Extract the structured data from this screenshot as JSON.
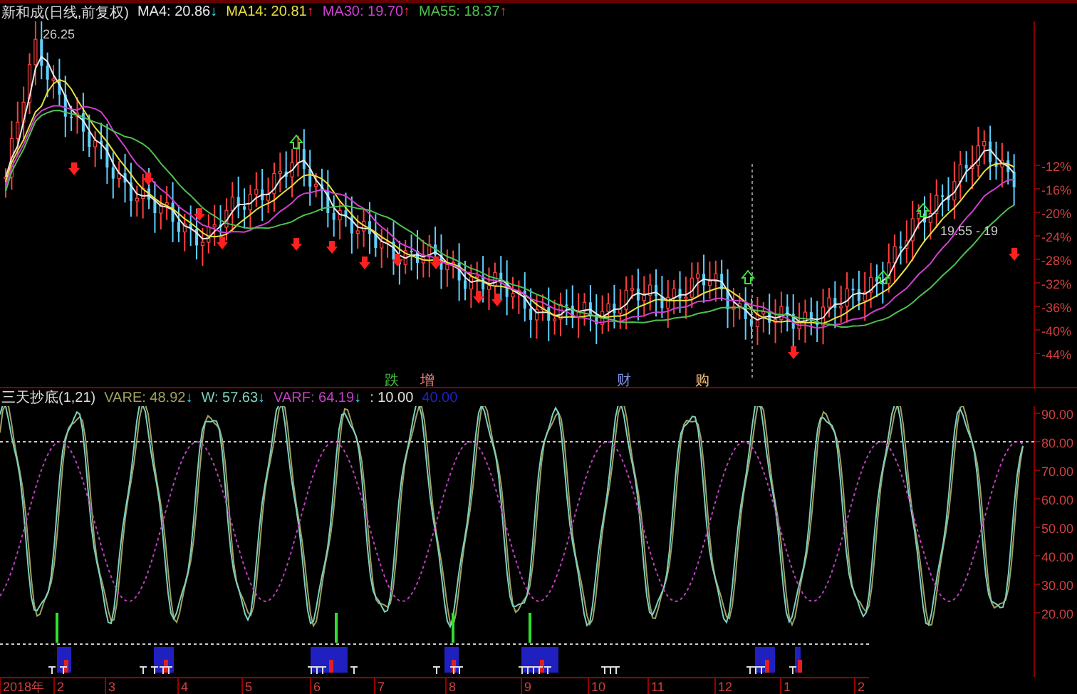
{
  "main_panel": {
    "title": "新和成(日线,前复权)",
    "indicators": [
      {
        "label": "MA4: 20.86",
        "arrow": "↓",
        "rising": false,
        "color": "#e8e8e8"
      },
      {
        "label": "MA14: 20.81",
        "arrow": "↑",
        "rising": true,
        "color": "#e8e040"
      },
      {
        "label": "MA30: 19.70",
        "arrow": "↑",
        "rising": true,
        "color": "#d040d0"
      },
      {
        "label": "MA55: 18.37",
        "arrow": "↑",
        "rising": true,
        "color": "#50c050"
      }
    ],
    "peak_label": "26.25",
    "price_label": "19.55 - 19",
    "axis_labels": [
      "-12%",
      "-16%",
      "-20%",
      "-24%",
      "-28%",
      "-32%",
      "-36%",
      "-40%",
      "-44%"
    ],
    "event_tags": [
      {
        "text": "跌",
        "color": "#40c040"
      },
      {
        "text": "增",
        "color": "#f08080"
      },
      {
        "text": "财",
        "color": "#8090e0"
      },
      {
        "text": "购",
        "color": "#f0c080"
      }
    ]
  },
  "indicator_panel": {
    "title": "三天抄底(1,21)",
    "values": [
      {
        "label": "VARE: 48.92",
        "arrow": "↓",
        "rising": false,
        "color": "#a0a060"
      },
      {
        "label": "W: 57.63",
        "arrow": "↓",
        "rising": false,
        "color": "#80d0c0"
      },
      {
        "label": "VARF: 64.19",
        "arrow": "↓",
        "rising": false,
        "color": "#c040c0"
      },
      {
        "label": ": 10.00",
        "color": "#e0e0e0"
      },
      {
        "label": "40.00",
        "color": "#2020c0"
      }
    ],
    "axis_labels": [
      "90.00",
      "80.00",
      "70.00",
      "60.00",
      "50.00",
      "40.00",
      "30.00",
      "20.00"
    ]
  },
  "time_axis": [
    "2018年",
    "2",
    "3",
    "4",
    "5",
    "6",
    "7",
    "8",
    "9",
    "10",
    "11",
    "12",
    "1",
    "2"
  ]
}
